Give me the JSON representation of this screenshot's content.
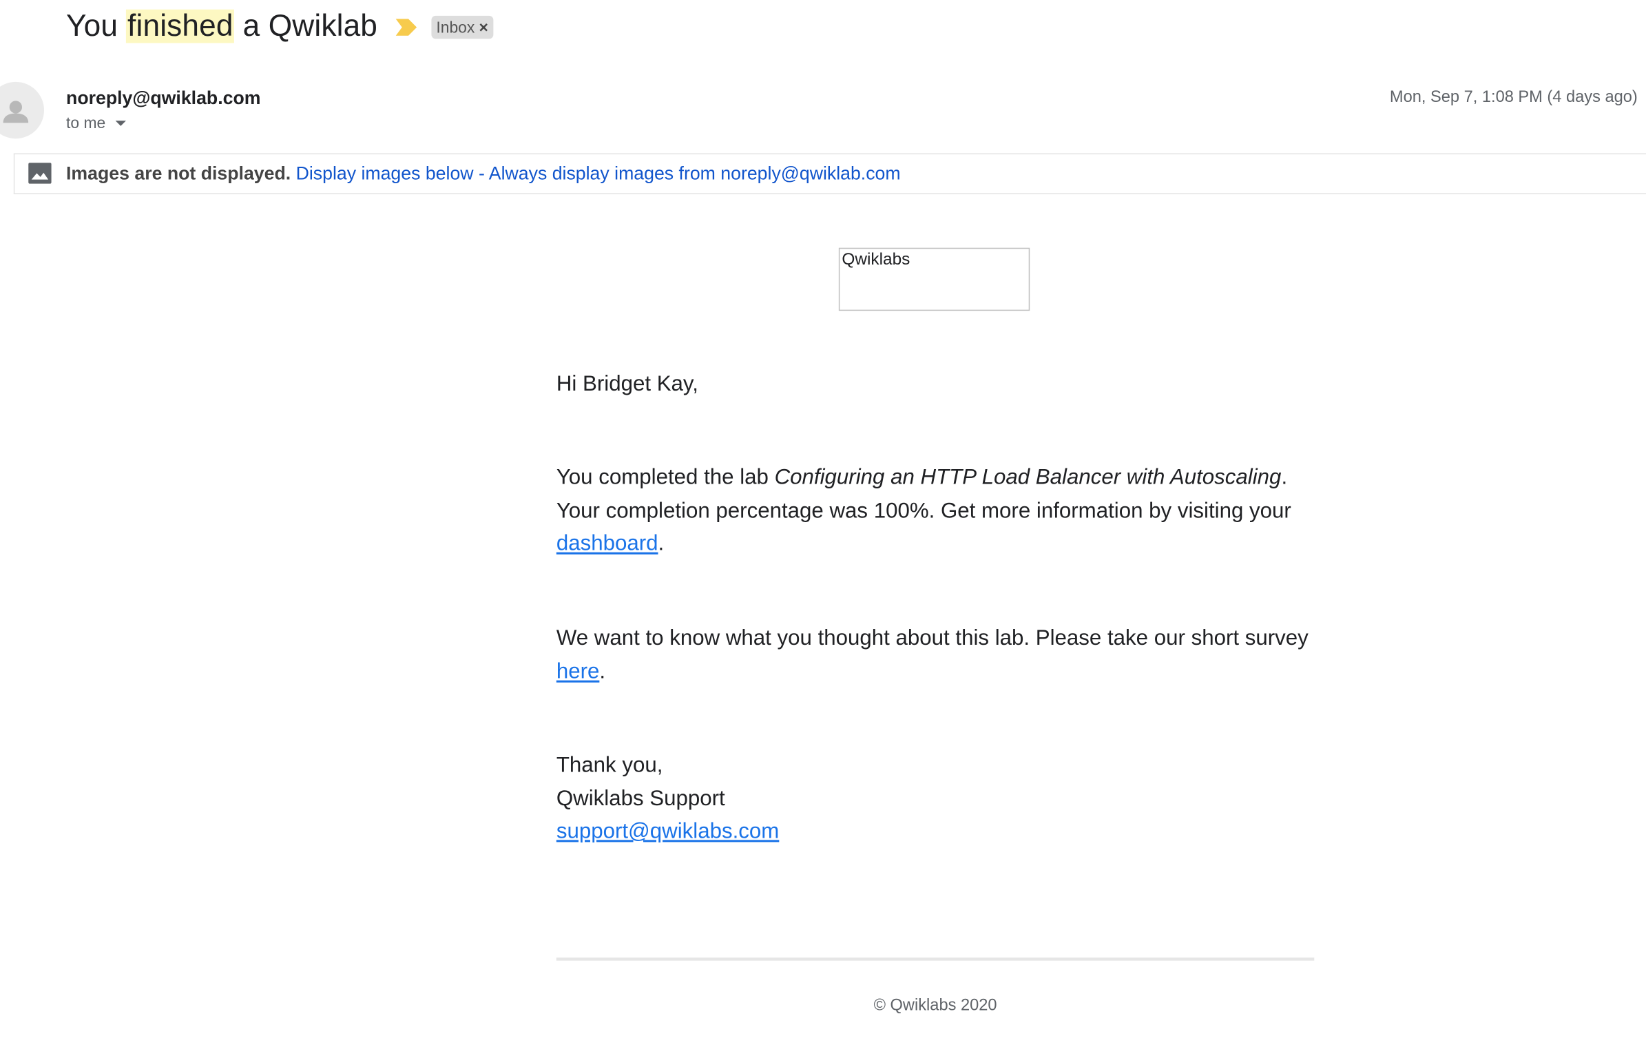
{
  "subject": {
    "before": "You ",
    "highlight": "finished",
    "after": " a Qwiklab",
    "importance_icon": "importance-marker-icon",
    "label": "Inbox",
    "label_close": "×"
  },
  "sender": {
    "email": "noreply@qwiklab.com",
    "to": "to me",
    "date": "Mon, Sep 7, 1:08 PM (4 days ago)",
    "avatar_icon": "person-avatar-icon"
  },
  "images_bar": {
    "icon": "image-icon",
    "notice": "Images are not displayed.",
    "display_below": "Display images below",
    "separator": " - ",
    "always_display": "Always display images from noreply@qwiklab.com"
  },
  "email_body": {
    "logo_alt": "Qwiklabs",
    "greeting": "Hi Bridget Kay,",
    "p1_start": "You completed the lab ",
    "lab_name": "Configuring an HTTP Load Balancer with Autoscaling",
    "p1_mid": ". Your completion percentage was 100%. Get more information by visiting your ",
    "dashboard_link": "dashboard",
    "p1_end": ".",
    "p2_start": "We want to know what you thought about this lab. Please take our short survey ",
    "here_link": "here",
    "p2_end": ".",
    "thanks": "Thank you,",
    "signature": "Qwiklabs Support",
    "support_email": "support@qwiklabs.com",
    "footer": "© Qwiklabs 2020"
  },
  "colors": {
    "highlight": "#fdf8c2",
    "importance": "#f7cb4d",
    "link": "#1155cc",
    "body_link": "#1a73e8"
  }
}
